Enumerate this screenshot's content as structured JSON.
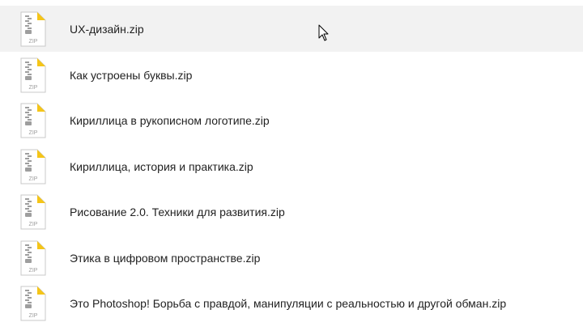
{
  "icon": {
    "name": "zip-file-icon",
    "label": "ZIP",
    "accent_color": "#f5c518",
    "line_color": "#9e9e9e"
  },
  "selection_color": "#f2f2f2",
  "files": [
    {
      "name": "UX-дизайн.zip",
      "selected": true
    },
    {
      "name": "Как устроены буквы.zip",
      "selected": false
    },
    {
      "name": "Кириллица в рукописном логотипе.zip",
      "selected": false
    },
    {
      "name": "Кириллица, история и практика.zip",
      "selected": false
    },
    {
      "name": "Рисование 2.0. Техники для развития.zip",
      "selected": false
    },
    {
      "name": "Этика в цифровом пространстве.zip",
      "selected": false
    },
    {
      "name": "Это Photoshop! Борьба с правдой, манипуляции с реальностью и другой обман.zip",
      "selected": false
    }
  ]
}
